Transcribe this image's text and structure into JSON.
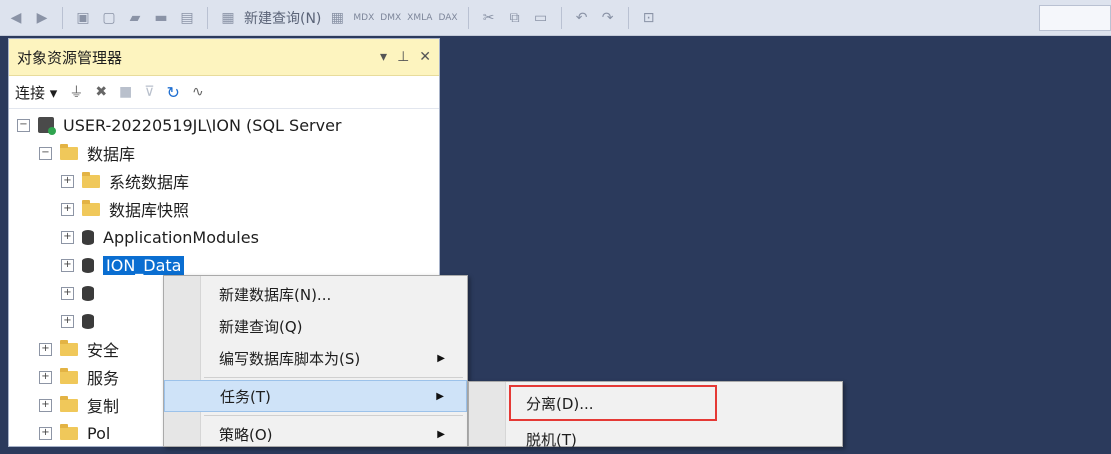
{
  "toolbar": {
    "new_query": "新建查询(N)",
    "mdx": "MDX",
    "dmx": "DMX",
    "xmla": "XMLA",
    "dax": "DAX"
  },
  "explorer": {
    "title": "对象资源管理器",
    "pin_glyph": "▾ ⊥ ✕",
    "connect_label": "连接 ▾"
  },
  "tree": {
    "server": "USER-20220519JL\\ION (SQL Server",
    "databases": "数据库",
    "system_dbs": "系统数据库",
    "db_snapshots": "数据库快照",
    "app_modules": "ApplicationModules",
    "selected_db": "ION_Data",
    "security": "安全",
    "server_objects": "服务",
    "replication": "复制",
    "extra": "Pol"
  },
  "context_menu": {
    "new_database": "新建数据库(N)...",
    "new_query": "新建查询(Q)",
    "script_as": "编写数据库脚本为(S)",
    "tasks": "任务(T)",
    "policies": "策略(O)"
  },
  "submenu": {
    "detach": "分离(D)...",
    "offline": "脱机(T)"
  },
  "colors": {
    "background": "#2b3a5c",
    "title_bar": "#fdf4bf",
    "selection": "#0a6ed1",
    "highlight_box": "#e53935"
  }
}
